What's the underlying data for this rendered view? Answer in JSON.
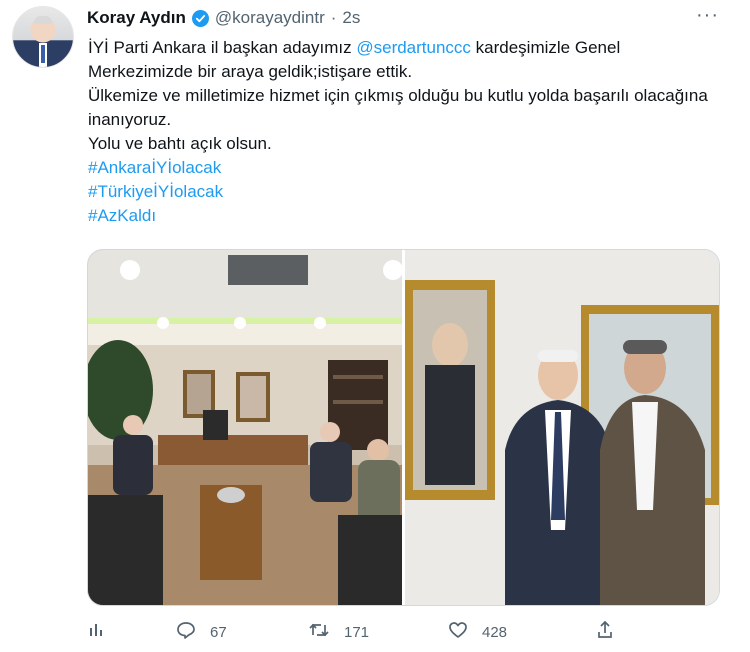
{
  "author": {
    "name": "Koray Aydın",
    "handle": "@korayaydintr",
    "separator": "·",
    "time": "2s"
  },
  "icons": {
    "verified": "verified-badge-icon",
    "more": "more-options-icon",
    "views": "analytics-icon",
    "reply": "reply-icon",
    "retweet": "retweet-icon",
    "like": "like-icon",
    "share": "share-icon"
  },
  "colors": {
    "accent": "#1d9bf0",
    "text": "#0f1419",
    "muted": "#536471"
  },
  "tweet": {
    "line1_pre": "İYİ Parti Ankara il başkan adayımız ",
    "mention": "@serdartunccc",
    "line1_post": " kardeşimizle Genel Merkezimizde bir araya geldik;istişare ettik.",
    "line2": "Ülkemize ve milletimize hizmet için çıkmış olduğu bu kutlu yolda başarılı olacağına inanıyoruz.",
    "line3": "Yolu ve bahtı açık olsun.",
    "hashtags": [
      "#AnkaraİYİolacak",
      "#TürkiyeİYİolacak",
      "#AzKaldı"
    ]
  },
  "more_label": "···",
  "stats": {
    "replies": "67",
    "retweets": "171",
    "likes": "428"
  }
}
